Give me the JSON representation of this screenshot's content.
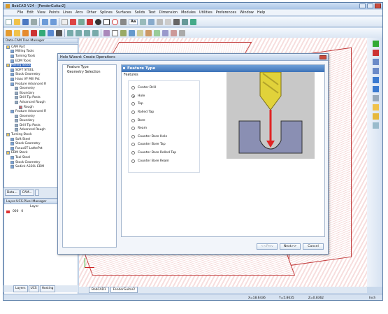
{
  "app": {
    "title": "BobCAD V24 - [FenderGuitar2]"
  },
  "menu": [
    "File",
    "Edit",
    "View",
    "Points",
    "Lines",
    "Arcs",
    "Other",
    "Splines",
    "Surfaces",
    "Solids",
    "Text",
    "Dimension",
    "Modules",
    "Utilities",
    "Preferences",
    "Window",
    "Help"
  ],
  "toolbar": {
    "text_tool_label": "Aa"
  },
  "cam_tree": {
    "title": "Data-CAM Tree Manager",
    "items": [
      {
        "label": "CAM Part",
        "indent": 0,
        "selected": false
      },
      {
        "label": "Milling Tools",
        "indent": 1,
        "selected": false
      },
      {
        "label": "Turning Tools",
        "indent": 1,
        "selected": false
      },
      {
        "label": "EDM Tools",
        "indent": 1,
        "selected": false
      },
      {
        "label": "Milling Stock",
        "indent": 0,
        "selected": true
      },
      {
        "label": "SOFT STEEL",
        "indent": 1,
        "selected": false
      },
      {
        "label": "Stock Geometry",
        "indent": 1,
        "selected": false
      },
      {
        "label": "Haas VF Mill Pst",
        "indent": 1,
        "selected": false
      },
      {
        "label": "Feature Advanced R",
        "indent": 1,
        "selected": false
      },
      {
        "label": "Geometry",
        "indent": 2,
        "selected": false
      },
      {
        "label": "Boundary",
        "indent": 2,
        "selected": false
      },
      {
        "label": "Drill Tip Posts",
        "indent": 2,
        "selected": false
      },
      {
        "label": "Advanced Rough",
        "indent": 2,
        "selected": false
      },
      {
        "label": "Rough",
        "indent": 3,
        "selected": false
      },
      {
        "label": "Feature Advanced R",
        "indent": 1,
        "selected": false
      },
      {
        "label": "Geometry",
        "indent": 2,
        "selected": false
      },
      {
        "label": "Boundary",
        "indent": 2,
        "selected": false
      },
      {
        "label": "Drill Tip Posts",
        "indent": 2,
        "selected": false
      },
      {
        "label": "Advanced Rough",
        "indent": 2,
        "selected": false
      },
      {
        "label": "Turning Stock",
        "indent": 0,
        "selected": false
      },
      {
        "label": "Soft Steel",
        "indent": 1,
        "selected": false
      },
      {
        "label": "Stock Geometry",
        "indent": 1,
        "selected": false
      },
      {
        "label": "Fanuc0T LathePst",
        "indent": 1,
        "selected": false
      },
      {
        "label": "EDM Stock",
        "indent": 0,
        "selected": false
      },
      {
        "label": "Tool Steel",
        "indent": 1,
        "selected": false
      },
      {
        "label": "Stock Geometry",
        "indent": 1,
        "selected": false
      },
      {
        "label": "Sodick A320L EDM",
        "indent": 1,
        "selected": false
      }
    ]
  },
  "panel_tabs": [
    "Data...",
    "CAM...",
    ""
  ],
  "layer_panel": {
    "title": "Layer-UCS-Pixel Manager",
    "col_layer": "Layer",
    "row_name": "000",
    "row_value": "0"
  },
  "bottom_tabs": [
    "Layers",
    "UCS",
    "Hosting"
  ],
  "doc_tabs": [
    "BobCAD1",
    "FenderGuitar2"
  ],
  "status": {
    "x": "X=18.6436",
    "y": "Y=5.8635",
    "z": "Z=0.8362",
    "unit": "Inch"
  },
  "dialog": {
    "title": "Hole Wizard: Create Operations",
    "nav": [
      "Feature Type",
      "Geometry Selection"
    ],
    "header": "Feature Type",
    "features_label": "Features",
    "options": [
      "Center Drill",
      "Hole",
      "Tap",
      "Rolled Tap",
      "Bore",
      "Ream",
      "Counter Bore Hole",
      "Counter Bore Tap",
      "Counter Bore Rolled Tap",
      "Counter Bore Ream"
    ],
    "selected_index": 1,
    "buttons": {
      "prev": "<<Prev",
      "next": "Next>>",
      "cancel": "Cancel"
    }
  },
  "colors": {
    "accent": "#3e73b8",
    "mesh": "#c23a3a",
    "drill": "#e1d23a",
    "arrow": "#e02424",
    "block": "#8a8fb3"
  }
}
